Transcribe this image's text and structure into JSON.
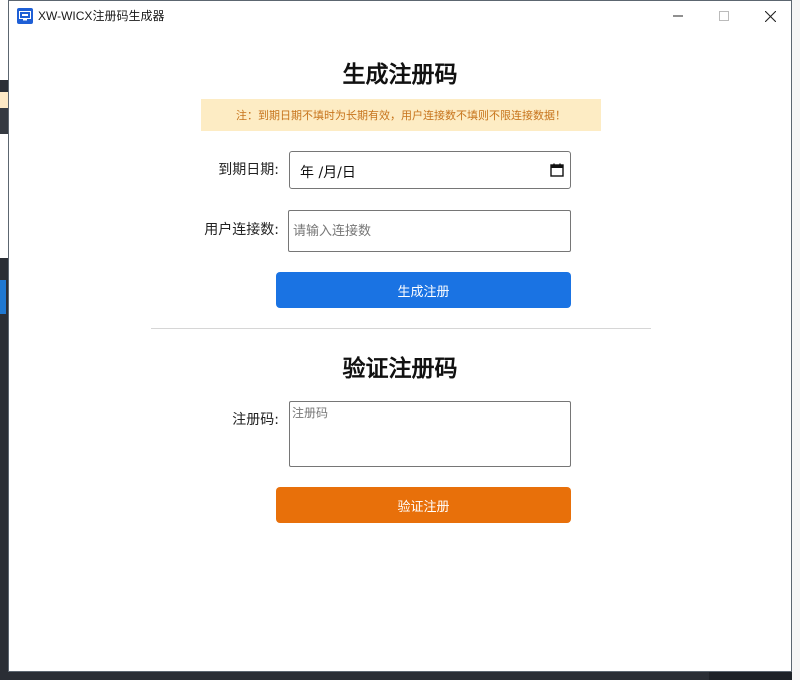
{
  "window": {
    "title": "XW-WICX注册码生成器"
  },
  "generate": {
    "heading": "生成注册码",
    "notice": "注：到期日期不填时为长期有效，用户连接数不填则不限连接数据！",
    "expiry_label": "到期日期:",
    "expiry_value": "年 /月/日",
    "users_label": "用户连接数:",
    "users_placeholder": "请输入连接数",
    "button_label": "生成注册"
  },
  "verify": {
    "heading": "验证注册码",
    "code_label": "注册码:",
    "code_placeholder": "注册码",
    "button_label": "验证注册"
  },
  "colors": {
    "generate_button": "#1a73e3",
    "verify_button": "#e8700a",
    "notice_bg": "#fdecc4",
    "notice_text": "#c7741c"
  },
  "icons": {
    "app": "app-icon",
    "minimize": "minimize-icon",
    "maximize": "maximize-icon",
    "close": "close-icon",
    "calendar": "calendar-icon"
  }
}
